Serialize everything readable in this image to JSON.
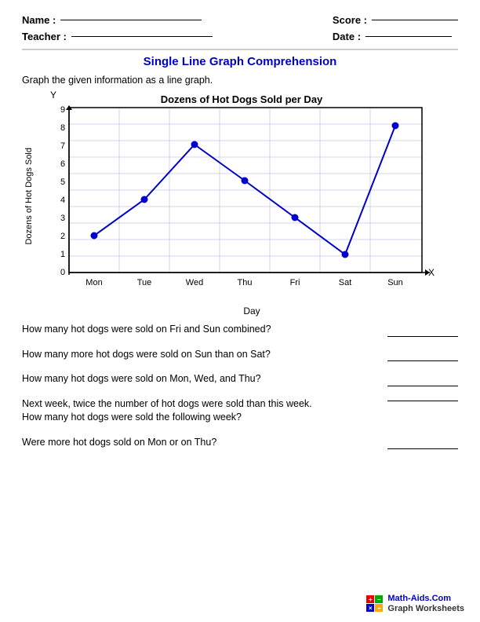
{
  "header": {
    "name_label": "Name :",
    "teacher_label": "Teacher :",
    "score_label": "Score :",
    "date_label": "Date :"
  },
  "title": "Single Line Graph Comprehension",
  "instruction": "Graph the given information as a line graph.",
  "chart": {
    "title": "Dozens of Hot Dogs Sold per Day",
    "y_axis_label": "Dozens of Hot Dogs Sold",
    "x_axis_label": "Day",
    "y_axis_title": "Y",
    "x_axis_title": "X",
    "x_labels": [
      "Mon",
      "Tue",
      "Wed",
      "Thu",
      "Fri",
      "Sat",
      "Sun"
    ],
    "y_values": [
      0,
      1,
      2,
      3,
      4,
      5,
      6,
      7,
      8,
      9
    ],
    "data_points": [
      {
        "day": "Mon",
        "value": 2
      },
      {
        "day": "Tue",
        "value": 4
      },
      {
        "day": "Wed",
        "value": 7
      },
      {
        "day": "Thu",
        "value": 5
      },
      {
        "day": "Fri",
        "value": 3
      },
      {
        "day": "Sat",
        "value": 1
      },
      {
        "day": "Sun",
        "value": 8
      }
    ]
  },
  "questions": [
    {
      "id": "q1",
      "text": "How many hot dogs were sold on Fri and Sun combined?"
    },
    {
      "id": "q2",
      "text": "How many more hot dogs were sold on Sun than on Sat?"
    },
    {
      "id": "q3",
      "text": "How many hot dogs were sold on Mon, Wed, and Thu?"
    },
    {
      "id": "q4",
      "text": "Next week, twice the number of hot dogs were sold than this week.\nHow many hot dogs were sold the following week?"
    },
    {
      "id": "q5",
      "text": "Were more hot dogs sold on Mon or on Thu?"
    }
  ],
  "footer": {
    "site": "Math-Aids.Com",
    "subtitle": "Graph Worksheets"
  }
}
